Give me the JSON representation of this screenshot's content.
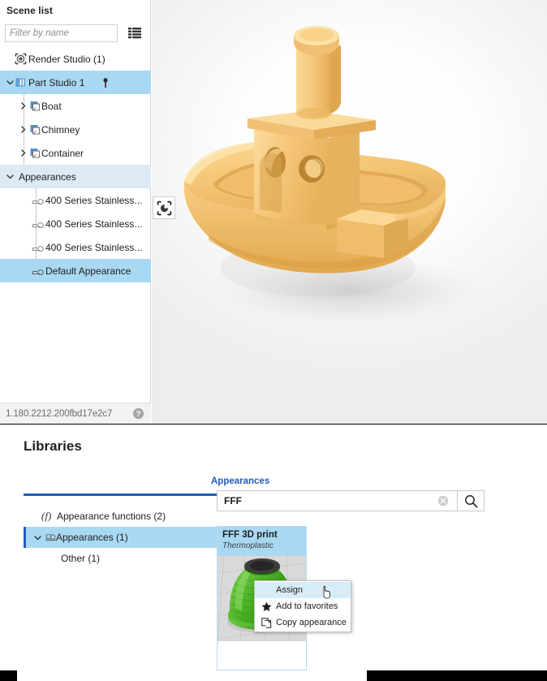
{
  "scene_panel": {
    "title": "Scene list",
    "filter_placeholder": "Filter by name",
    "filter_value": "",
    "list_view_icon": "list-view-icon",
    "tree": [
      {
        "label": "Render Studio (1)",
        "icon": "render-studio-icon",
        "depth": 0,
        "twisty": "none",
        "selected": false,
        "section": false
      },
      {
        "label": "Part Studio 1",
        "icon": "part-studio-icon",
        "depth": 0,
        "twisty": "down",
        "selected": true,
        "section": false
      },
      {
        "label": "Boat",
        "icon": "part-icon",
        "depth": 1,
        "twisty": "right",
        "selected": false,
        "section": false
      },
      {
        "label": "Chimney",
        "icon": "part-icon",
        "depth": 1,
        "twisty": "right",
        "selected": false,
        "section": false
      },
      {
        "label": "Container",
        "icon": "part-icon",
        "depth": 1,
        "twisty": "right",
        "selected": false,
        "section": false
      },
      {
        "label": "Appearances",
        "icon": "none",
        "depth": 0,
        "twisty": "down",
        "selected": false,
        "section": true
      },
      {
        "label": "400 Series Stainless...",
        "icon": "appearance-icon",
        "depth": 2,
        "twisty": "none",
        "selected": false,
        "section": false
      },
      {
        "label": "400 Series Stainless...",
        "icon": "appearance-icon",
        "depth": 2,
        "twisty": "none",
        "selected": false,
        "section": false
      },
      {
        "label": "400 Series Stainless...",
        "icon": "appearance-icon",
        "depth": 2,
        "twisty": "none",
        "selected": false,
        "section": false
      },
      {
        "label": "Default Appearance",
        "icon": "appearance-icon",
        "depth": 2,
        "twisty": "none",
        "selected": true,
        "section": false
      }
    ],
    "version": "1.180.2212.200fbd17e2c7",
    "help_icon": "help-icon"
  },
  "viewport": {
    "model_name": "3DBenchy boat",
    "model_color": "#f3c46d",
    "floating_button_icon": "render-view-icon"
  },
  "libraries": {
    "title": "Libraries",
    "tabs": [
      {
        "label": "Appearances",
        "active": true
      }
    ],
    "tree": [
      {
        "label": "Appearance functions (2)",
        "icon": "function-icon",
        "depth": 0,
        "twisty": "none",
        "selected": false
      },
      {
        "label": "Appearances (1)",
        "icon": "appearances-library-icon",
        "depth": 0,
        "twisty": "down",
        "selected": true
      },
      {
        "label": "Other (1)",
        "icon": "none",
        "depth": 1,
        "twisty": "none",
        "selected": false
      }
    ],
    "search": {
      "value": "FFF",
      "placeholder": "Search",
      "clear_icon": "clear-icon",
      "search_icon": "search-icon"
    },
    "cards": [
      {
        "name": "FFF 3D print",
        "subtitle": "Thermoplastic",
        "thumbnail": "green-3d-print-vase",
        "selected": true
      }
    ],
    "context_menu": [
      {
        "label": "Assign",
        "icon": "none",
        "active": true
      },
      {
        "label": "Add to favorites",
        "icon": "star-icon",
        "active": false
      },
      {
        "label": "Copy appearance",
        "icon": "copy-icon",
        "active": false
      }
    ]
  },
  "colors": {
    "selection": "#a9d9f2",
    "accent": "#1f5bbf",
    "section": "#dbeaf4",
    "model": "#f3c46d"
  }
}
